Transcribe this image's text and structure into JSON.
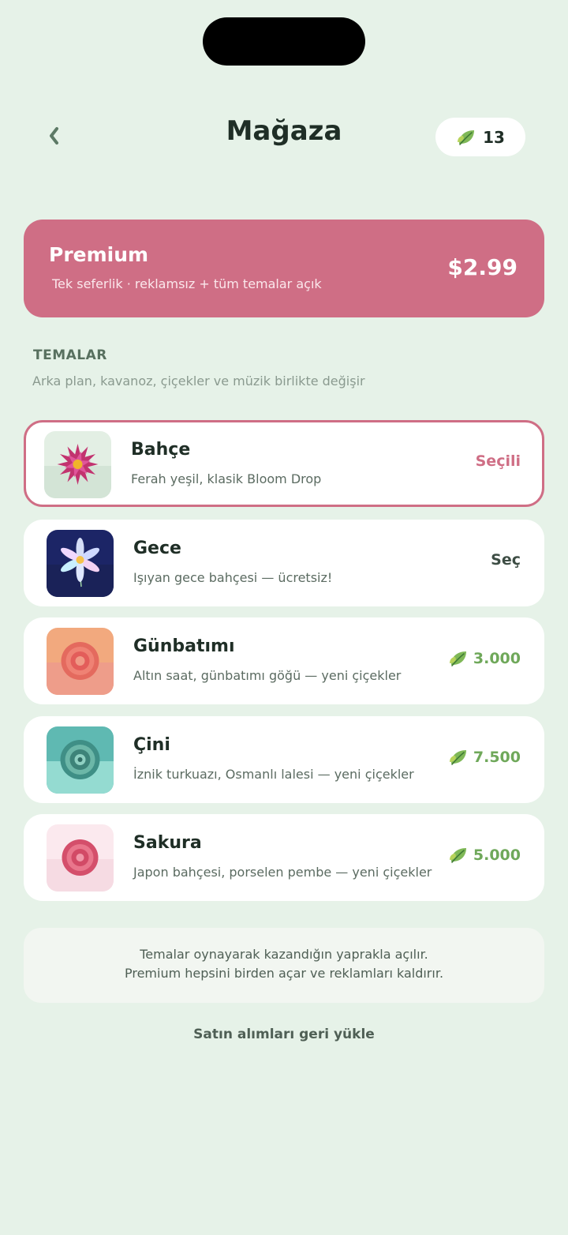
{
  "header": {
    "title": "Mağaza",
    "leaf_count": "13"
  },
  "premium": {
    "title": "Premium",
    "subtitle": "Tek seferlik · reklamsız + tüm temalar açık",
    "price": "$2.99"
  },
  "themes_section": {
    "title": "TEMALAR",
    "subtitle": "Arka plan, kavanoz, çiçekler ve müzik birlikte değişir"
  },
  "themes": [
    {
      "name": "Bahçe",
      "desc": "Ferah yeşil, klasik Bloom Drop",
      "action": "Seçili",
      "icon": "magenta-dahlia-icon"
    },
    {
      "name": "Gece",
      "desc": "Işıyan gece bahçesi — ücretsiz!",
      "action": "Seç",
      "icon": "glowing-lily-icon"
    },
    {
      "name": "Günbatımı",
      "desc": "Altın saat, günbatımı göğü — yeni çiçekler",
      "price": "3.000",
      "icon": "coral-dahlia-icon"
    },
    {
      "name": "Çini",
      "desc": "İznik turkuazı, Osmanlı lalesi — yeni çiçekler",
      "price": "7.500",
      "icon": "teal-rose-icon"
    },
    {
      "name": "Sakura",
      "desc": "Japon bahçesi, porselen pembe — yeni çiçekler",
      "price": "5.000",
      "icon": "pink-camellia-icon"
    }
  ],
  "info": {
    "line1": "Temalar oynayarak kazandığın yaprakla açılır.",
    "line2": "Premium hepsini birden açar ve reklamları kaldırır."
  },
  "restore_label": "Satın alımları geri yükle",
  "colors": {
    "background": "#e6f2e8",
    "accent_pink": "#cf6e85",
    "leaf_green": "#6fa85a",
    "text_dark": "#1f2e26"
  }
}
